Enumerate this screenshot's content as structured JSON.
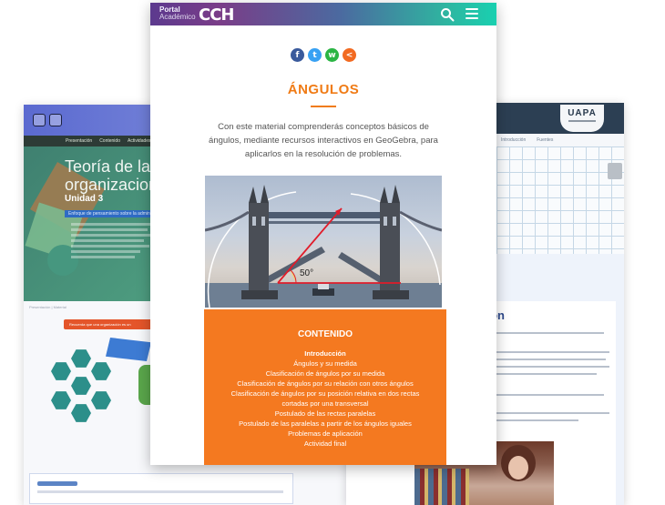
{
  "left_card": {
    "nav": [
      "Presentación",
      "Contenido",
      "Actividades"
    ],
    "hero_title_line1": "Teoría de las",
    "hero_title_line2": "organizaciones",
    "unit": "Unidad 3",
    "tag": "Enfoque de pensamiento sobre la administración",
    "breadcrumb": "Presentación | Material",
    "orange_banner": "Recuerda que una organización es un"
  },
  "right_card": {
    "logo": "UAPA",
    "nav": [
      "Introducción",
      "Fuentes"
    ],
    "heading": "cción"
  },
  "phone": {
    "header": {
      "brand_line1": "Portal",
      "brand_line2": "Académico",
      "brand_mark": "CCH"
    },
    "social": {
      "facebook": "f",
      "twitter": "t",
      "whatsapp": "w",
      "share": "<"
    },
    "title": "ÁNGULOS",
    "intro": "Con este material comprenderás conceptos básicos de ángulos, mediante recursos interactivos en GeoGebra, para aplicarlos en la resolución de problemas.",
    "image_angle_label": "50°",
    "content": {
      "title": "CONTENIDO",
      "items": [
        "Introducción",
        "Ángulos y su medida",
        "Clasificación de ángulos por su medida",
        "Clasificación de ángulos por su relación con otros ángulos",
        "Clasificación de ángulos por su posición relativa en dos rectas cortadas por una transversal",
        "Postulado de las rectas paralelas",
        "Postulado de las paralelas a partir de los ángulos iguales",
        "Problemas de aplicación",
        "Actividad final"
      ]
    }
  },
  "colors": {
    "accent_orange": "#f47920",
    "title_orange": "#f07b15",
    "header_start": "#5c3a8e",
    "header_end": "#19d0b0"
  }
}
